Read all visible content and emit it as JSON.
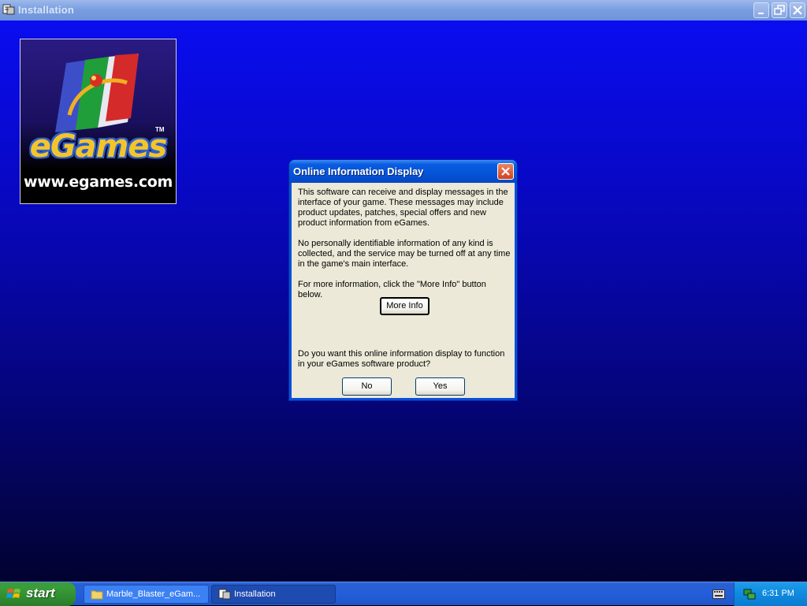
{
  "window": {
    "title": "Installation",
    "colors": {
      "titlebar": "#7a9fe0",
      "background_top": "#0a0df0",
      "background_bottom": "#020230"
    }
  },
  "logo": {
    "brand": "eGames",
    "trademark": "TM",
    "url": "www.egames.com"
  },
  "dialog": {
    "title": "Online Information Display",
    "paragraphs": [
      "This software can receive and display messages in the\ninterface of your game.  These messages may include\nproduct updates, patches, special offers and new\nproduct information from eGames.",
      "No personally identifiable information of any kind is\ncollected, and the service may be turned off at any time\nin the game's main interface.",
      "For more information, click the \"More Info\" button below."
    ],
    "more_info_label": "More Info",
    "question": "Do you want this online information display to function\nin your eGames software product?",
    "no_label": "No",
    "yes_label": "Yes"
  },
  "taskbar": {
    "start_label": "start",
    "tasks": [
      {
        "label": "Marble_Blaster_eGam...",
        "icon": "folder-icon"
      },
      {
        "label": "Installation",
        "icon": "installer-icon"
      }
    ],
    "clock": "6:31 PM"
  }
}
